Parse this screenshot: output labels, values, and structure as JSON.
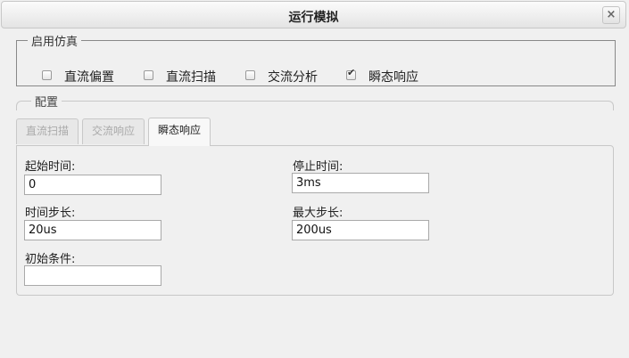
{
  "dialog": {
    "title": "运行模拟",
    "close_icon": "close-icon",
    "close_glyph": "×"
  },
  "simulation": {
    "legend": "启用仿真",
    "options": [
      {
        "label": "直流偏置",
        "checked": false
      },
      {
        "label": "直流扫描",
        "checked": false
      },
      {
        "label": "交流分析",
        "checked": false
      },
      {
        "label": "瞬态响应",
        "checked": true
      }
    ]
  },
  "config": {
    "legend": "配置",
    "tabs": [
      {
        "label": "直流扫描",
        "active": false
      },
      {
        "label": "交流响应",
        "active": false
      },
      {
        "label": "瞬态响应",
        "active": true
      }
    ],
    "transient": {
      "start_time": {
        "label": "起始时间:",
        "value": "0"
      },
      "stop_time": {
        "label": "停止时间:",
        "value": "3ms"
      },
      "time_step": {
        "label": "时间步长:",
        "value": "20us"
      },
      "max_step": {
        "label": "最大步长:",
        "value": "200us"
      },
      "initial_condition": {
        "label": "初始条件:",
        "value": ""
      }
    }
  }
}
